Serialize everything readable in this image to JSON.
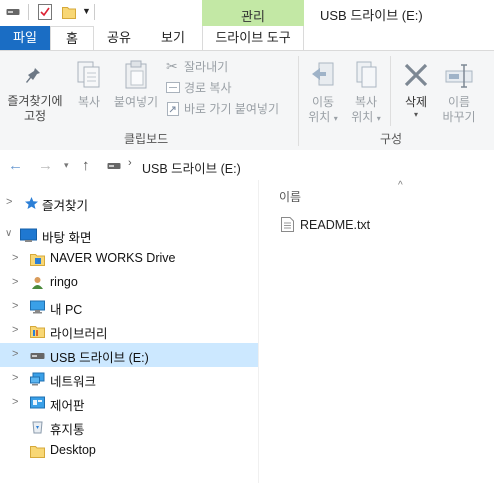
{
  "titlebar": {
    "context_tab_label": "관리",
    "window_title": "USB 드라이브 (E:)"
  },
  "tabs": {
    "file": "파일",
    "home": "홈",
    "share": "공유",
    "view": "보기",
    "drive_tools": "드라이브 도구"
  },
  "ribbon": {
    "pin_line1": "즐겨찾기에",
    "pin_line2": "고정",
    "copy": "복사",
    "paste": "붙여넣기",
    "cut": "잘라내기",
    "copy_path": "경로 복사",
    "paste_shortcut": "바로 가기 붙여넣기",
    "clipboard_group": "클립보드",
    "move_line1": "이동",
    "move_line2": "위치",
    "copyto_line1": "복사",
    "copyto_line2": "위치",
    "delete": "삭제",
    "rename_line1": "이름",
    "rename_line2": "바꾸기",
    "organize_group": "구성"
  },
  "address": {
    "path": "USB 드라이브 (E:)"
  },
  "nav": {
    "items": [
      {
        "label": "즐겨찾기",
        "icon": "star-icon"
      },
      {
        "label": "바탕 화면",
        "icon": "desktop-icon"
      },
      {
        "label": "NAVER WORKS Drive",
        "icon": "naver-works-drive-icon"
      },
      {
        "label": "ringo",
        "icon": "user-folder-icon"
      },
      {
        "label": "내 PC",
        "icon": "pc-icon"
      },
      {
        "label": "라이브러리",
        "icon": "library-icon"
      },
      {
        "label": "USB 드라이브 (E:)",
        "icon": "usb-drive-icon"
      },
      {
        "label": "네트워크",
        "icon": "network-icon"
      },
      {
        "label": "제어판",
        "icon": "control-panel-icon"
      },
      {
        "label": "휴지통",
        "icon": "recycle-bin-icon"
      },
      {
        "label": "Desktop",
        "icon": "folder-icon"
      }
    ]
  },
  "content": {
    "column_name": "이름",
    "files": [
      {
        "name": "README.txt",
        "icon": "text-file-icon"
      }
    ]
  }
}
